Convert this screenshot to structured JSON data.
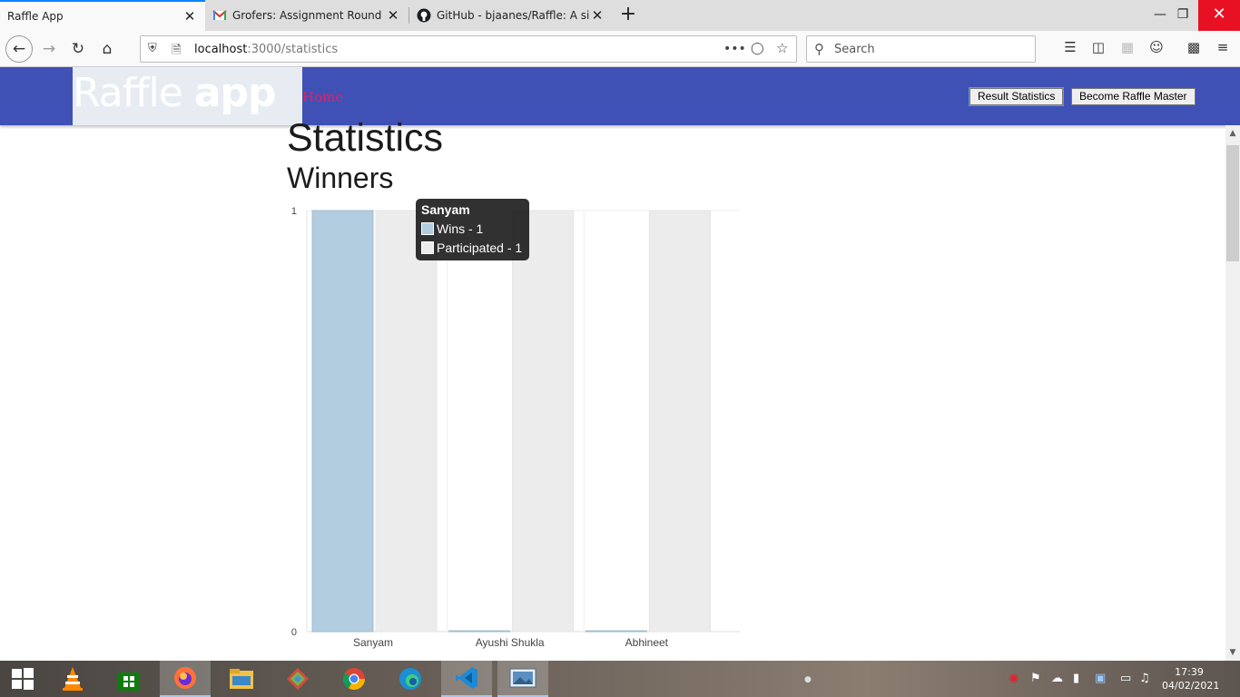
{
  "browser": {
    "tabs": [
      {
        "title": "Raffle App",
        "active": true
      },
      {
        "title": "Grofers: Assignment Round | In",
        "active": false
      },
      {
        "title": "GitHub - bjaanes/Raffle: A simp",
        "active": false
      }
    ],
    "url_host": "localhost",
    "url_path": ":3000/statistics",
    "search_placeholder": "Search"
  },
  "app": {
    "logo_light": "Raffle ",
    "logo_bold": "app",
    "home_link": "Home",
    "buttons": {
      "result_statistics": "Result Statistics",
      "become_master": "Become Raffle Master"
    },
    "page_title": "Statistics",
    "section_title": "Winners"
  },
  "chart_data": {
    "type": "bar",
    "categories": [
      "Sanyam",
      "Ayushi Shukla",
      "Abhineet"
    ],
    "series": [
      {
        "name": "Wins",
        "values": [
          1,
          0,
          0
        ],
        "color": "#b3cde0"
      },
      {
        "name": "Participated",
        "values": [
          1,
          1,
          1
        ],
        "color": "#ececec"
      }
    ],
    "ylim": [
      0,
      1
    ],
    "yticks": [
      "0",
      "1"
    ],
    "tooltip": {
      "title": "Sanyam",
      "rows": [
        "Wins - 1",
        "Participated - 1"
      ]
    }
  },
  "taskbar": {
    "time": "17:39",
    "date": "04/02/2021"
  }
}
